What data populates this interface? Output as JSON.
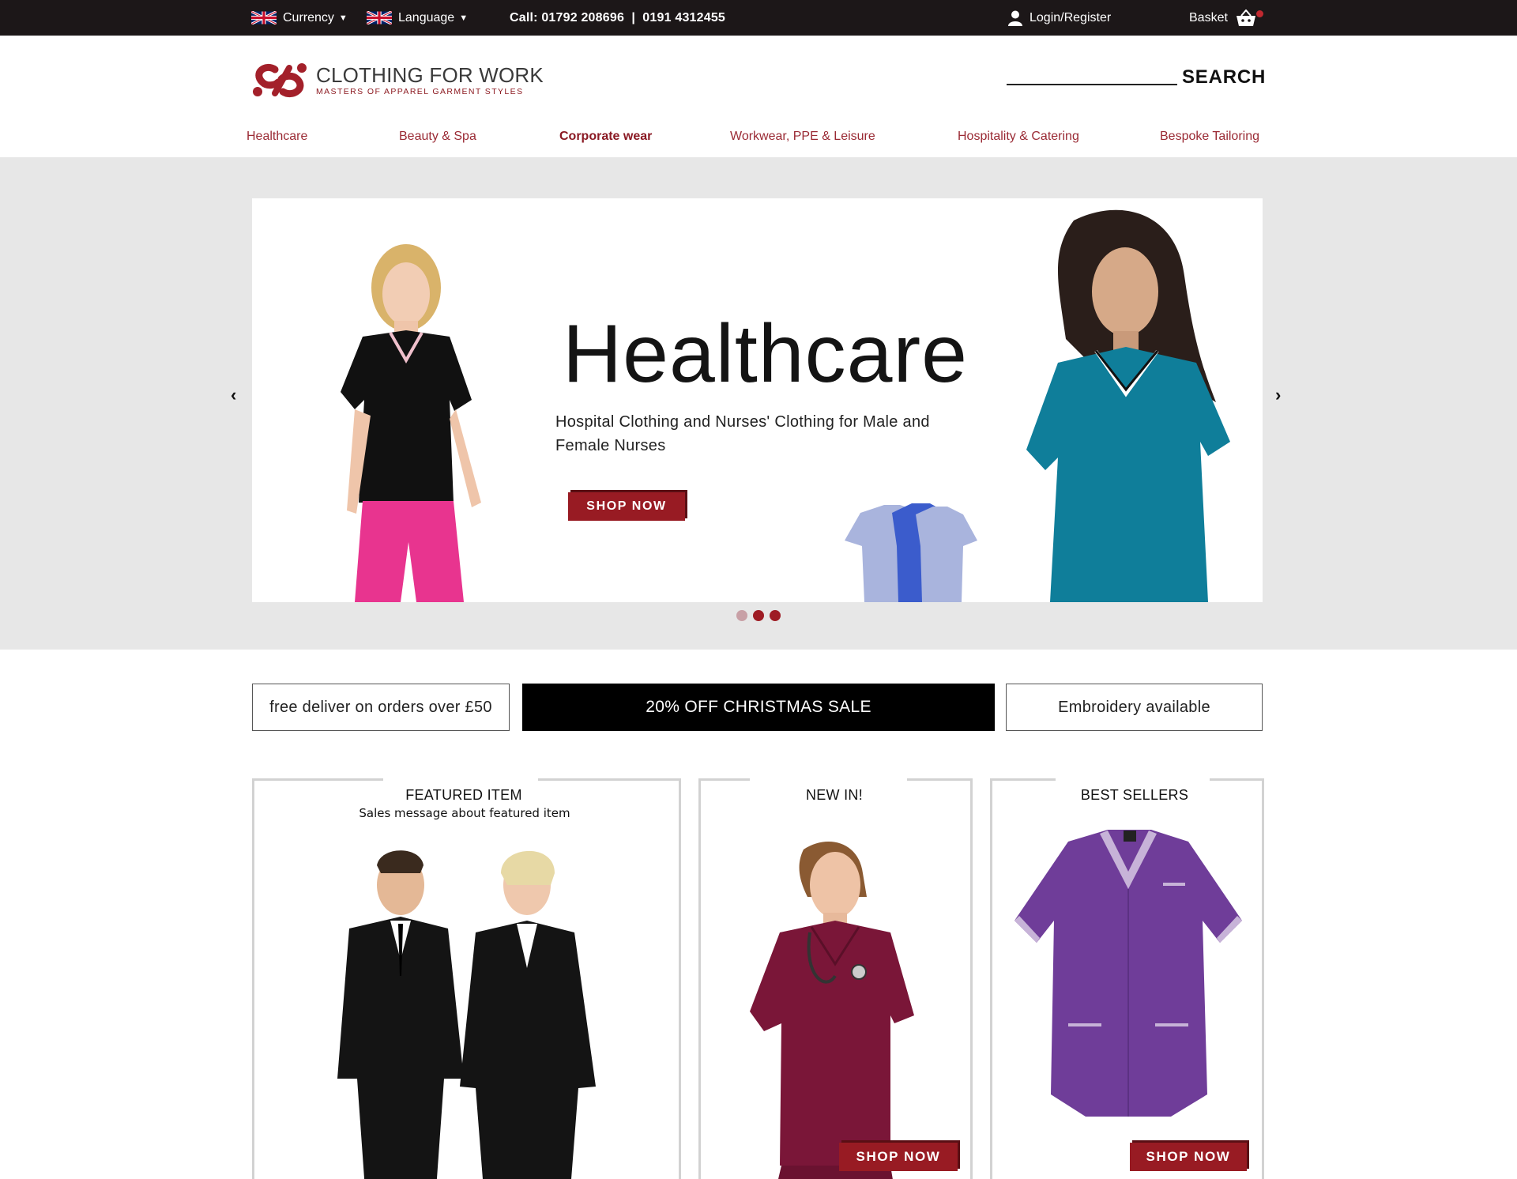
{
  "topbar": {
    "currency_label": "Currency",
    "language_label": "Language",
    "call_text": "Call: 01792 208696  |  0191 4312455",
    "login_label": "Login/Register",
    "basket_label": "Basket"
  },
  "header": {
    "logo_title": "CLOTHING FOR WORK",
    "logo_subtitle": "MASTERS OF APPAREL GARMENT STYLES",
    "search_label": "SEARCH"
  },
  "nav": {
    "items": [
      {
        "label": "Healthcare"
      },
      {
        "label": "Beauty & Spa"
      },
      {
        "label": "Corporate wear"
      },
      {
        "label": "Workwear, PPE & Leisure"
      },
      {
        "label": "Hospitality & Catering"
      },
      {
        "label": "Bespoke Tailoring"
      }
    ],
    "active_index": 2
  },
  "hero": {
    "title": "Healthcare",
    "subtitle": "Hospital Clothing and Nurses' Clothing for Male and Female Nurses",
    "cta": "SHOP NOW",
    "slide_count": 3,
    "active_slide": 1
  },
  "promos": {
    "delivery": "free deliver on orders over £50",
    "sale": "20% OFF CHRISTMAS SALE",
    "embroidery": "Embroidery available"
  },
  "cards": {
    "featured": {
      "title": "FEATURED ITEM",
      "message": "Sales message about featured item"
    },
    "new_in": {
      "title": "NEW IN!",
      "cta": "SHOP NOW"
    },
    "best_sellers": {
      "title": "BEST SELLERS",
      "cta": "SHOP NOW"
    }
  },
  "colors": {
    "brand_red": "#981b23",
    "topbar_bg": "#1c1718",
    "nav_text": "#9a2a34",
    "hero_bg": "#e7e7e7"
  },
  "icons": [
    "uk-flag-icon",
    "user-icon",
    "basket-icon",
    "chevron-left-icon",
    "chevron-right-icon",
    "logo-icon"
  ]
}
